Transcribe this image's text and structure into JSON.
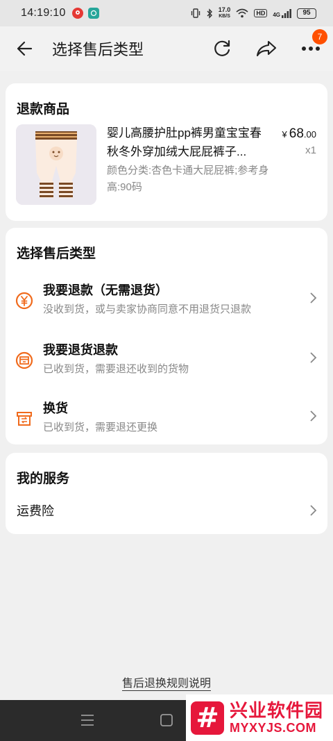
{
  "status_bar": {
    "time": "14:19:10",
    "net_speed_value": "17.0",
    "net_speed_unit": "KB/S",
    "hd": "HD",
    "network": "4G",
    "battery": "95"
  },
  "header": {
    "title": "选择售后类型",
    "more_badge": "7"
  },
  "refund_goods": {
    "title": "退款商品",
    "product": {
      "name": "婴儿高腰护肚pp裤男童宝宝春秋冬外穿加绒大屁屁裤子...",
      "spec": "颜色分类:杏色卡通大屁屁裤;参考身高:90码",
      "price_symbol": "¥",
      "price_int": "68",
      "price_dec": ".00",
      "qty": "x1"
    }
  },
  "aftersale": {
    "title": "选择售后类型",
    "options": [
      {
        "title": "我要退款（无需退货）",
        "desc": "没收到货，或与卖家协商同意不用退货只退款",
        "icon": "yen-icon"
      },
      {
        "title": "我要退货退款",
        "desc": "已收到货，需要退还收到的货物",
        "icon": "return-box-icon"
      },
      {
        "title": "换货",
        "desc": "已收到货，需要退还更换",
        "icon": "exchange-box-icon"
      }
    ]
  },
  "services": {
    "title": "我的服务",
    "items": [
      {
        "label": "运费险"
      }
    ]
  },
  "footer": {
    "rules_link": "售后退换规则说明"
  },
  "watermark": {
    "cn": "兴业软件园",
    "en": "MYXYJS.COM"
  },
  "colors": {
    "accent": "#ff5000",
    "icon_orange": "#f06a1c",
    "watermark_red": "#e6173b"
  }
}
